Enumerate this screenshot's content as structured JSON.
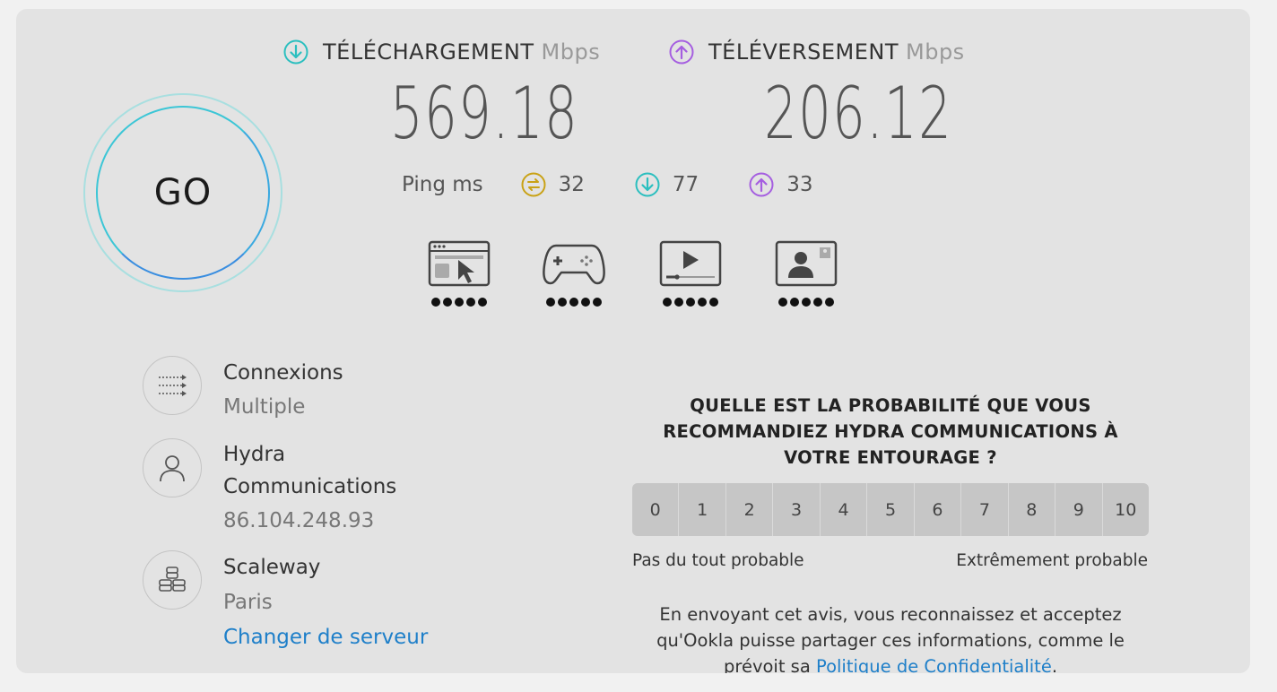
{
  "go_button": {
    "label": "GO"
  },
  "download": {
    "label": "TÉLÉCHARGEMENT",
    "unit": "Mbps",
    "value": "569.18",
    "color": "#2bbfbf"
  },
  "upload": {
    "label": "TÉLÉVERSEMENT",
    "unit": "Mbps",
    "value": "206.12",
    "color": "#a55ee0"
  },
  "ping": {
    "label": "Ping ms",
    "idle": {
      "value": "32",
      "icon": "idle-latency-icon",
      "color": "#c9a216"
    },
    "download": {
      "value": "77",
      "icon": "download-latency-icon",
      "color": "#2bbfbf"
    },
    "upload": {
      "value": "33",
      "icon": "upload-latency-icon",
      "color": "#a55ee0"
    }
  },
  "activities": [
    {
      "icon": "web-browsing-icon",
      "rating": 5
    },
    {
      "icon": "gaming-icon",
      "rating": 5
    },
    {
      "icon": "video-streaming-icon",
      "rating": 5
    },
    {
      "icon": "video-chat-icon",
      "rating": 5
    }
  ],
  "connections": {
    "title": "Connexions",
    "value": "Multiple"
  },
  "isp": {
    "name_line1": "Hydra",
    "name_line2": "Communications",
    "ip": "86.104.248.93"
  },
  "server": {
    "name": "Scaleway",
    "location": "Paris",
    "change_link": "Changer de serveur"
  },
  "survey": {
    "question": "QUELLE EST LA PROBABILITÉ QUE VOUS RECOMMANDIEZ HYDRA COMMUNICATIONS À VOTRE ENTOURAGE ?",
    "scale": [
      "0",
      "1",
      "2",
      "3",
      "4",
      "5",
      "6",
      "7",
      "8",
      "9",
      "10"
    ],
    "low_label": "Pas du tout probable",
    "high_label": "Extrêmement probable",
    "disclaimer_prefix": "En envoyant cet avis, vous reconnaissez et acceptez qu'Ookla puisse partager ces informations, comme le prévoit sa ",
    "privacy_link": "Politique de Confidentialité",
    "disclaimer_suffix": "."
  }
}
